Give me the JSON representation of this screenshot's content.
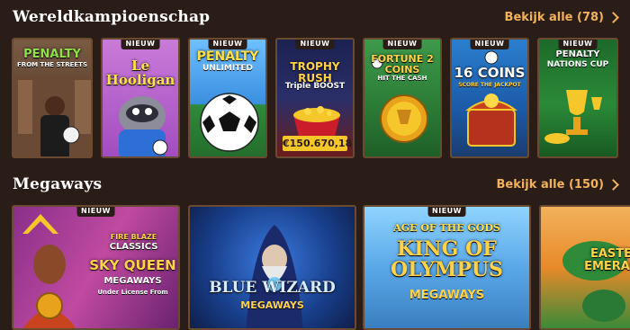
{
  "sections": [
    {
      "title": "Wereldkampioenschap",
      "see_all": "Bekijk alle (78)",
      "games": [
        {
          "title": "PENALTY",
          "subtitle": "FROM THE STREETS",
          "badge": ""
        },
        {
          "title": "Le Hooligan",
          "subtitle": "",
          "badge": "NIEUW"
        },
        {
          "title": "PENALTY",
          "subtitle": "UNLIMITED",
          "badge": "NIEUW"
        },
        {
          "title": "TROPHY RUSH",
          "subtitle": "Triple BOOST",
          "badge": "NIEUW",
          "jackpot": "€150.670,18"
        },
        {
          "title": "FORTUNE 2 COINS",
          "subtitle": "HIT THE CASH",
          "badge": "NIEUW"
        },
        {
          "title": "16 COINS",
          "subtitle": "SCORE THE JACKPOT",
          "badge": "NIEUW"
        },
        {
          "title": "PENALTY",
          "subtitle": "NATIONS CUP",
          "badge": "NIEUW"
        }
      ]
    },
    {
      "title": "Megaways",
      "see_all": "Bekijk alle (150)",
      "games": [
        {
          "title": "SKY QUEEN",
          "subtitle": "MEGAWAYS",
          "badge": "NIEUW",
          "top_label": "FIRE BLAZE",
          "top_label2": "CLASSICS",
          "license": "Under License From"
        },
        {
          "title": "BLUE WIZARD",
          "subtitle": "MEGAWAYS",
          "badge": ""
        },
        {
          "title": "KING OF OLYMPUS",
          "subtitle": "MEGAWAYS",
          "badge": "NIEUW",
          "top_label": "AGE OF THE GODS"
        },
        {
          "title": "EASTER EMERALD",
          "subtitle": "",
          "badge": ""
        }
      ]
    }
  ]
}
